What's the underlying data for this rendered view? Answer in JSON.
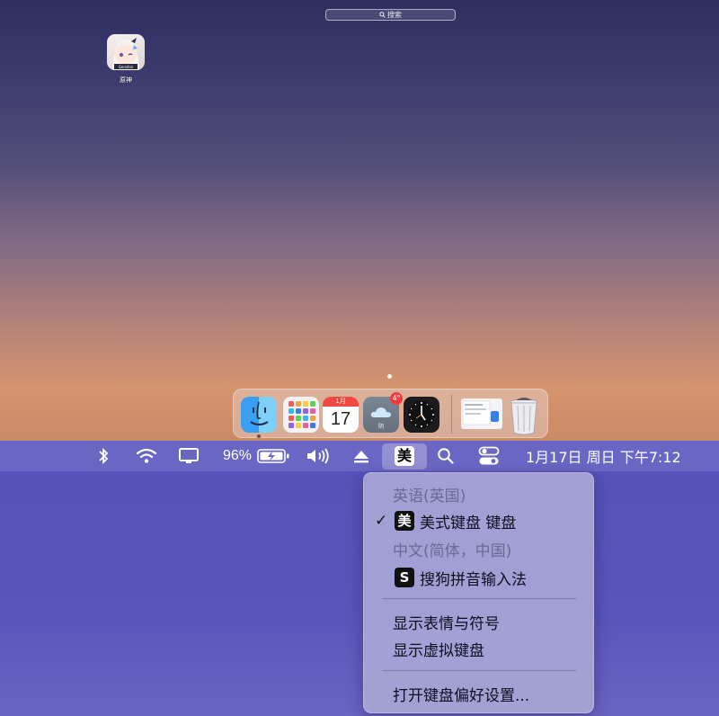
{
  "desktop": {
    "search": {
      "label": "搜索"
    },
    "app": {
      "name": "原神",
      "badge_text": "Genshin"
    },
    "dock": {
      "calendar": {
        "month": "1月",
        "day": "17"
      },
      "weather": {
        "badge": "4°",
        "condition": "阴"
      }
    }
  },
  "menubar": {
    "battery_percent": "96%",
    "ime_label": "美",
    "datetime": "1月17日 周日 下午7:12"
  },
  "input_menu": {
    "header_en": "英语(英国)",
    "us_keyboard": {
      "icon": "美",
      "label": "美式键盘 键盘",
      "checked": "✓"
    },
    "header_zh": "中文(简体，中国)",
    "sogou": {
      "icon": "S",
      "label": "搜狗拼音输入法"
    },
    "show_emoji": "显示表情与符号",
    "show_virtual_keyboard": "显示虚拟键盘",
    "open_preferences": "打开键盘偏好设置..."
  },
  "colors": {
    "menubar": "#6a66c4",
    "menu_background": "#a8a6d6",
    "calendar_red": "#ee4a3f",
    "badge_red": "#f13d3d"
  }
}
